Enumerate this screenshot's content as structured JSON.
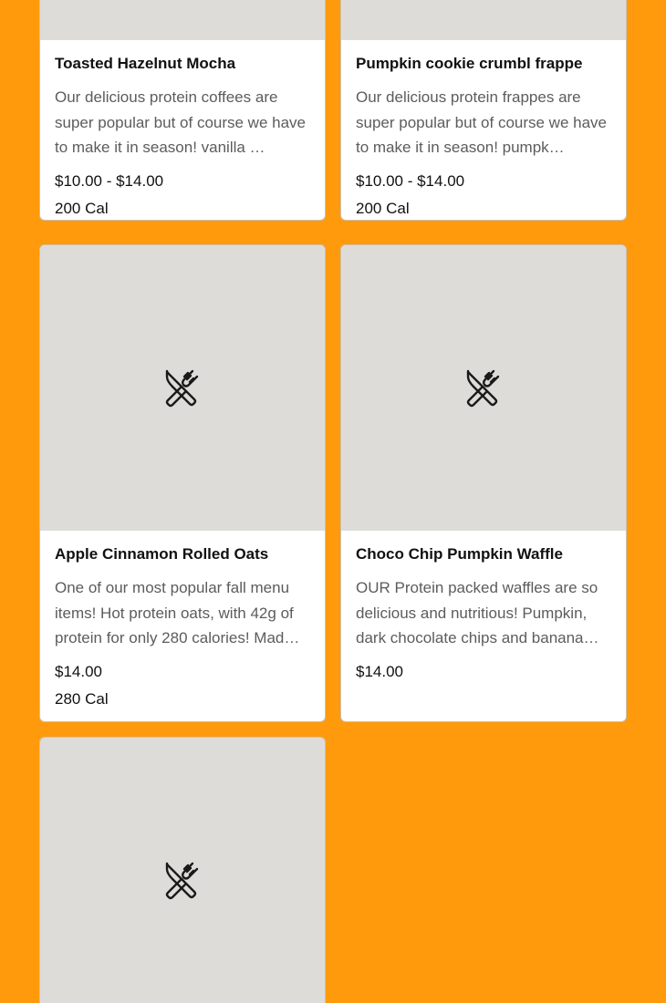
{
  "colors": {
    "page_background": "#FF9A0D",
    "card_background": "#FFFFFF",
    "image_placeholder": "#DEDCD9",
    "title_text": "#111111",
    "description_text": "#5C5C5C"
  },
  "menu_items": [
    {
      "title": "Toasted Hazelnut Mocha",
      "description": "Our delicious protein coffees are super popular but of course we have to make it in season! vanilla …",
      "price": "$10.00 - $14.00",
      "calories": "200 Cal",
      "image_icon": "utensils-icon"
    },
    {
      "title": "Pumpkin cookie crumbl frappe",
      "description": "Our delicious protein frappes are super popular but of course we have to make it in season! pumpk…",
      "price": "$10.00 - $14.00",
      "calories": "200 Cal",
      "image_icon": "utensils-icon"
    },
    {
      "title": "Apple Cinnamon Rolled Oats",
      "description": "One of our most popular fall menu items! Hot protein oats, with 42g of protein for only 280 calories! Mad…",
      "price": "$14.00",
      "calories": "280 Cal",
      "image_icon": "utensils-icon"
    },
    {
      "title": "Choco Chip Pumpkin Waffle",
      "description": "OUR Protein packed waffles are so delicious and nutritious! Pumpkin, dark chocolate chips and banana…",
      "price": "$14.00",
      "calories": "",
      "image_icon": "utensils-icon"
    },
    {
      "title": "",
      "description": "",
      "price": "",
      "calories": "",
      "image_icon": "utensils-icon"
    }
  ]
}
